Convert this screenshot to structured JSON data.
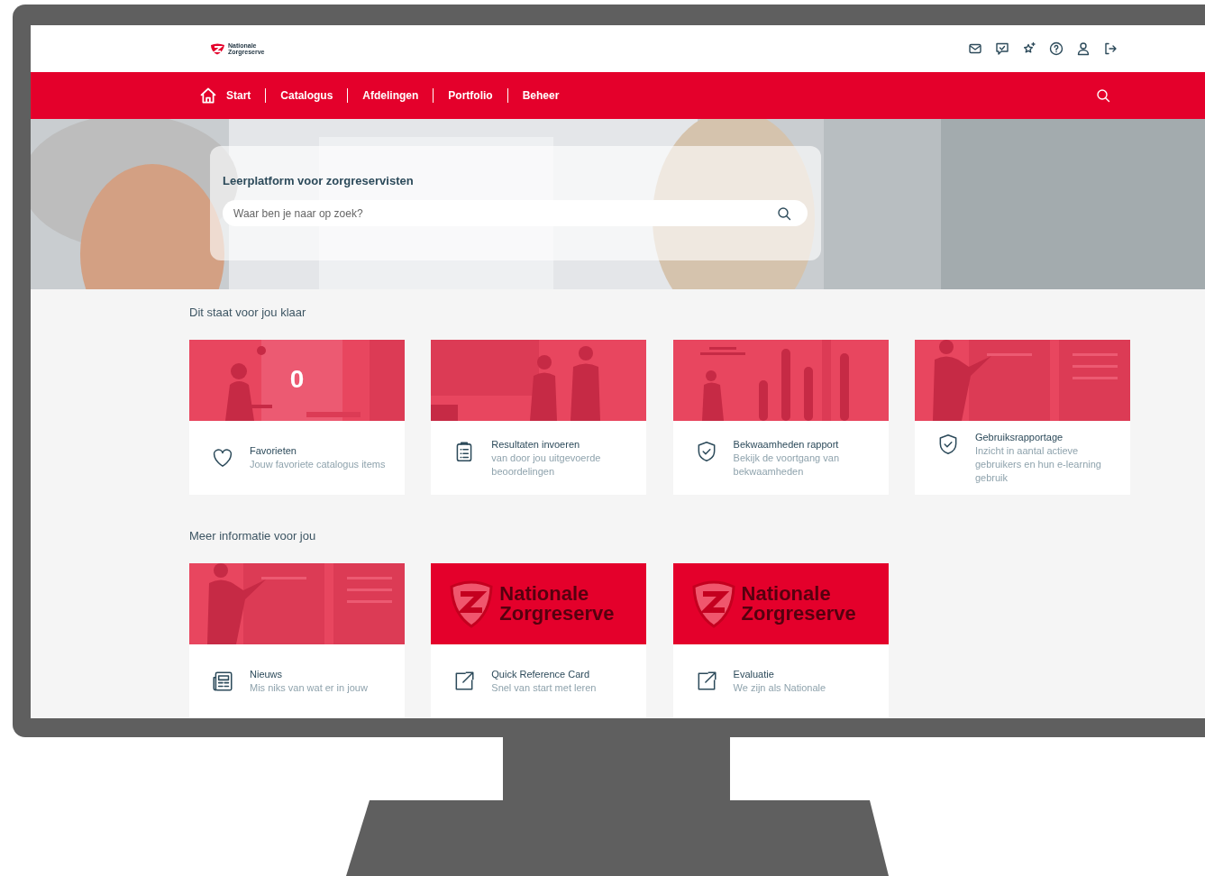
{
  "header": {
    "logo": {
      "line_1": "Nationale",
      "line_2": "Zorgreserve"
    }
  },
  "nav": {
    "items": [
      {
        "label": "Start"
      },
      {
        "label": "Catalogus"
      },
      {
        "label": "Afdelingen"
      },
      {
        "label": "Portfolio"
      },
      {
        "label": "Beheer"
      }
    ]
  },
  "hero": {
    "kind": "picture",
    "title": "Leerplatform voor zorgreservisten",
    "search": {
      "placeholder": "Waar ben je naar op zoek?"
    }
  },
  "sections": [
    {
      "title": "Dit staat voor jou klaar",
      "cards": [
        {
          "image": {
            "kind": "illustration"
          },
          "count": "0",
          "title": "Favorieten",
          "description": "Jouw favoriete catalogus items"
        },
        {
          "image": {
            "kind": "illustration"
          },
          "title": "Resultaten invoeren",
          "description": "van door jou uitgevoerde beoordelingen"
        },
        {
          "image": {
            "kind": "illustration"
          },
          "title": "Bekwaamheden rapport",
          "description": "Bekijk de voortgang van bekwaamheden"
        },
        {
          "image": {
            "kind": "illustration"
          },
          "title": "Gebruiksrapportage",
          "description": "Inzicht in aantal actieve gebruikers en hun e-learning gebruik"
        }
      ]
    },
    {
      "title": "Meer informatie voor jou",
      "cards": [
        {
          "image": {
            "kind": "illustration"
          },
          "title": "Nieuws",
          "description": "Mis niks van wat er in jouw"
        },
        {
          "image": {
            "kind": "logo",
            "line_1": "Nationale",
            "line_2": "Zorgreserve"
          },
          "title": "Quick Reference Card",
          "description": "Snel van start met leren"
        },
        {
          "image": {
            "kind": "logo",
            "line_1": "Nationale",
            "line_2": "Zorgreserve"
          },
          "title": "Evaluatie",
          "description": "We zijn als Nationale"
        }
      ]
    }
  ]
}
